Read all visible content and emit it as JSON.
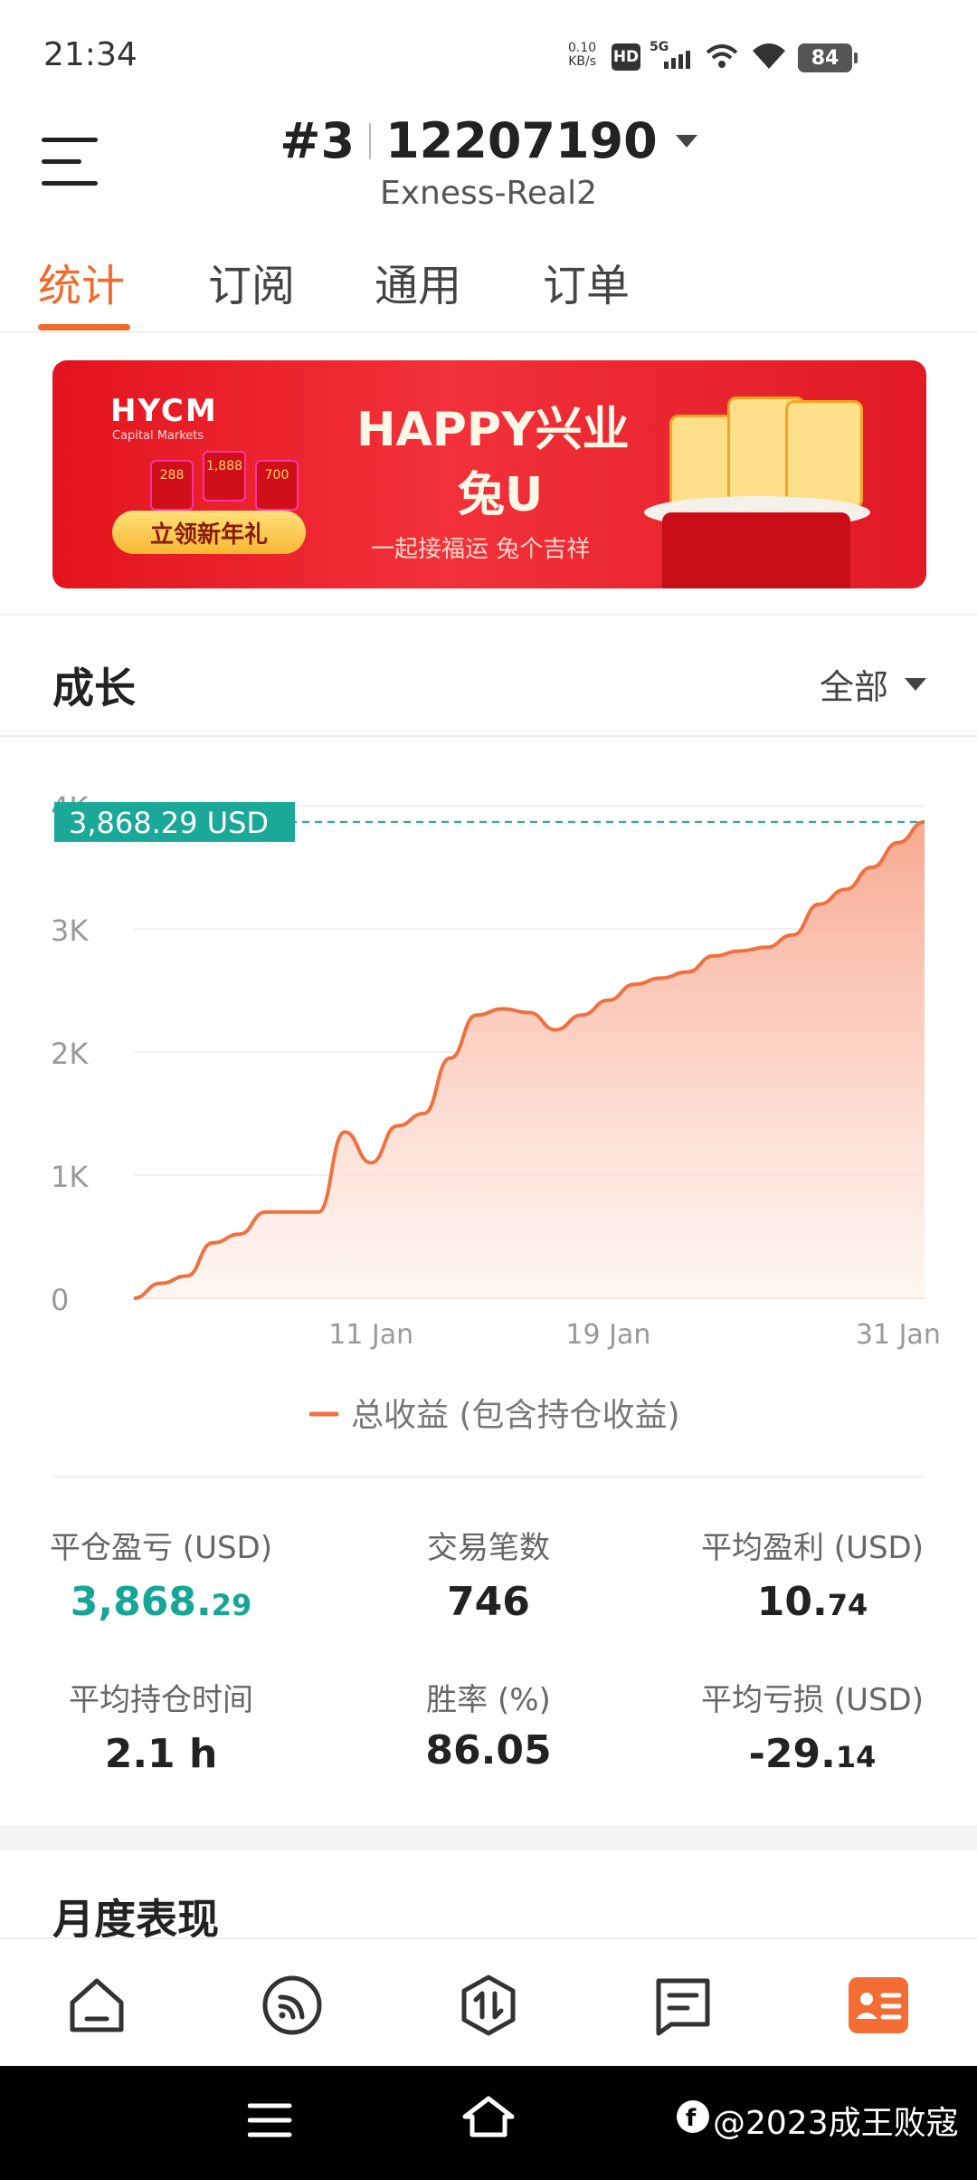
{
  "status_bar": {
    "time": "21:34",
    "net_speed_value": "0.10",
    "net_speed_unit": "KB/s",
    "hd_label": "HD",
    "network": "5G",
    "battery": "84"
  },
  "header": {
    "account_index": "#3",
    "account_number": "12207190",
    "server": "Exness-Real2"
  },
  "tabs": [
    {
      "label": "统计",
      "active": true
    },
    {
      "label": "订阅",
      "active": false
    },
    {
      "label": "通用",
      "active": false
    },
    {
      "label": "订单",
      "active": false
    }
  ],
  "banner": {
    "logo": "HYCM",
    "logo_sub": "Capital Markets",
    "headline_1": "HAPPY兴业",
    "headline_2": "兔U",
    "subline": "一起接福运 兔个吉祥",
    "cta": "立领新年礼",
    "packets": [
      "288",
      "1,888",
      "700"
    ]
  },
  "growth": {
    "title": "成长",
    "filter": "全部"
  },
  "chart_data": {
    "type": "area",
    "current_label": "3,868.29 USD",
    "current_value": 3868.29,
    "y_ticks": [
      "0",
      "1K",
      "2K",
      "3K",
      "4K"
    ],
    "ylim": [
      0,
      4000
    ],
    "x_ticks": [
      "11 Jan",
      "19 Jan",
      "31 Jan"
    ],
    "series": [
      {
        "name": "总收益 (包含持仓收益)",
        "color": "#f07040",
        "values": [
          0,
          120,
          180,
          450,
          520,
          700,
          700,
          700,
          1350,
          1100,
          1400,
          1500,
          1950,
          2300,
          2350,
          2320,
          2180,
          2300,
          2420,
          2550,
          2600,
          2650,
          2780,
          2820,
          2850,
          2950,
          3200,
          3320,
          3500,
          3700,
          3868.29
        ]
      }
    ],
    "grid": true,
    "legend": "bottom-center"
  },
  "stats": [
    {
      "label": "平仓盈亏 (USD)",
      "value_main": "3,868.",
      "value_frac": "29",
      "color": "green"
    },
    {
      "label": "交易笔数",
      "value_main": "746",
      "value_frac": "",
      "color": "default"
    },
    {
      "label": "平均盈利 (USD)",
      "value_main": "10.",
      "value_frac": "74",
      "color": "default"
    },
    {
      "label": "平均持仓时间",
      "value_main": "2.1 h",
      "value_frac": "",
      "color": "default"
    },
    {
      "label": "胜率 (%)",
      "value_main": "86.05",
      "value_frac": "",
      "color": "default"
    },
    {
      "label": "平均亏损 (USD)",
      "value_main": "-29.",
      "value_frac": "14",
      "color": "default"
    }
  ],
  "monthly": {
    "title": "月度表现"
  },
  "bottom_nav": [
    "home-icon",
    "feed-icon",
    "trade-icon",
    "messages-icon",
    "profile-icon"
  ],
  "watermark": "@2023成王败寇",
  "colors": {
    "accent": "#f06a2a",
    "profit": "#16a596",
    "highlight": "#1aa898"
  }
}
